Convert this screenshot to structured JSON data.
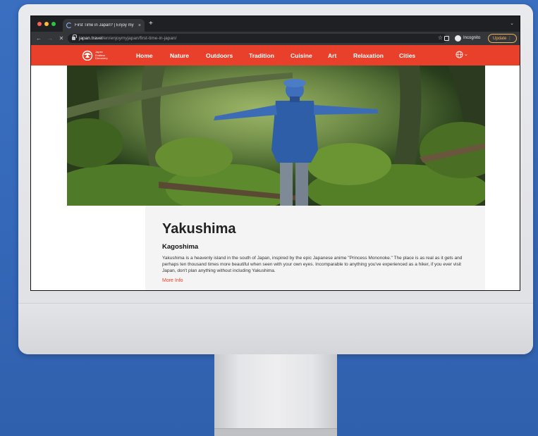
{
  "browser": {
    "tab_title": "First Time in Japan? | Enjoy my",
    "tab_close": "×",
    "new_tab": "+",
    "tab_menu": "⌄",
    "url_host": "japan.travel",
    "url_path": "/en/enjoymyjapan/first-time-in-japan/",
    "back": "←",
    "forward": "→",
    "stop": "✕",
    "star": "☆",
    "incognito_label": "Incognito",
    "update_label": "Update ⋮"
  },
  "site": {
    "logo_text": "Japan Endless Discovery.",
    "nav_items": [
      "Home",
      "Nature",
      "Outdoors",
      "Tradition",
      "Cuisine",
      "Art",
      "Relaxation",
      "Cities"
    ],
    "language_chevron": "⌄"
  },
  "card": {
    "title": "Yakushima",
    "subtitle": "Kagoshima",
    "description": "Yakushima is a heavenly island in the south of Japan, inspired by the epic Japanese anime \"Princess Mononoke.\" The place is as real as it gets and perhaps ten thousand times more beautiful when seen with your own eyes. Incomparable to anything you've experienced as a hiker, if you ever visit Japan, don't plan anything without including Yakushima.",
    "link": "More Info"
  },
  "colors": {
    "brand_red": "#e8402a",
    "backdrop_blue": "#3568b9"
  }
}
